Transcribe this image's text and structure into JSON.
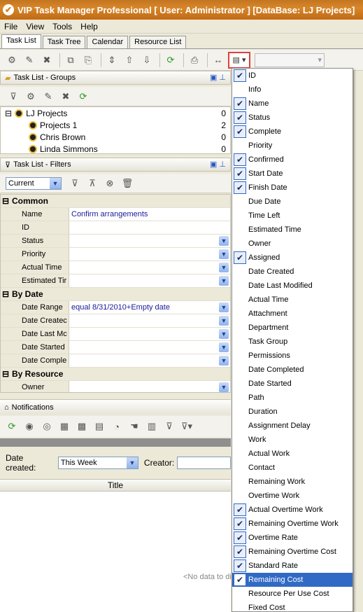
{
  "window": {
    "title": "VIP Task Manager Professional [ User: Administrator ] [DataBase: LJ Projects]"
  },
  "menubar": [
    "File",
    "View",
    "Tools",
    "Help"
  ],
  "tabs": [
    "Task List",
    "Task Tree",
    "Calendar",
    "Resource List"
  ],
  "groups_panel": {
    "title": "Task List - Groups",
    "items": [
      {
        "label": "LJ Projects",
        "count": "0"
      },
      {
        "label": "Projects 1",
        "count": "2"
      },
      {
        "label": "Chris Brown",
        "count": "0"
      },
      {
        "label": "Linda Simmons",
        "count": "0"
      }
    ]
  },
  "filters_panel": {
    "title": "Task List - Filters",
    "current_value": "Current",
    "categories": [
      {
        "name": "Common",
        "rows": [
          {
            "name": "Name",
            "value": "Confirm arrangements",
            "dropdown": false
          },
          {
            "name": "ID",
            "value": "",
            "dropdown": false
          },
          {
            "name": "Status",
            "value": "",
            "dropdown": true
          },
          {
            "name": "Priority",
            "value": "",
            "dropdown": true
          },
          {
            "name": "Actual Time",
            "value": "",
            "dropdown": true
          },
          {
            "name": "Estimated Tir",
            "value": "",
            "dropdown": true
          }
        ]
      },
      {
        "name": "By Date",
        "rows": [
          {
            "name": "Date Range",
            "value": "equal 8/31/2010+Empty date",
            "dropdown": true
          },
          {
            "name": "Date Createc",
            "value": "",
            "dropdown": true
          },
          {
            "name": "Date Last Mc",
            "value": "",
            "dropdown": true
          },
          {
            "name": "Date Started",
            "value": "",
            "dropdown": true
          },
          {
            "name": "Date Comple",
            "value": "",
            "dropdown": true
          }
        ]
      },
      {
        "name": "By Resource",
        "rows": [
          {
            "name": "Owner",
            "value": "",
            "dropdown": true
          }
        ]
      }
    ]
  },
  "notifications": {
    "title": "Notifications",
    "date_created_label": "Date created:",
    "date_created_value": "This Week",
    "creator_label": "Creator:",
    "column_title": "Title",
    "empty_text": "<No data to di"
  },
  "column_menu": {
    "items": [
      {
        "label": "ID",
        "checked": true
      },
      {
        "label": "Info",
        "checked": false
      },
      {
        "label": "Name",
        "checked": true
      },
      {
        "label": "Status",
        "checked": true
      },
      {
        "label": "Complete",
        "checked": true
      },
      {
        "label": "Priority",
        "checked": false
      },
      {
        "label": "Confirmed",
        "checked": true
      },
      {
        "label": "Start Date",
        "checked": true
      },
      {
        "label": "Finish Date",
        "checked": true
      },
      {
        "label": "Due Date",
        "checked": false
      },
      {
        "label": "Time Left",
        "checked": false
      },
      {
        "label": "Estimated Time",
        "checked": false
      },
      {
        "label": "Owner",
        "checked": false
      },
      {
        "label": "Assigned",
        "checked": true
      },
      {
        "label": "Date Created",
        "checked": false
      },
      {
        "label": "Date Last Modified",
        "checked": false
      },
      {
        "label": "Actual Time",
        "checked": false
      },
      {
        "label": "Attachment",
        "checked": false
      },
      {
        "label": "Department",
        "checked": false
      },
      {
        "label": "Task Group",
        "checked": false
      },
      {
        "label": "Permissions",
        "checked": false
      },
      {
        "label": "Date Completed",
        "checked": false
      },
      {
        "label": "Date Started",
        "checked": false
      },
      {
        "label": "Path",
        "checked": false
      },
      {
        "label": "Duration",
        "checked": false
      },
      {
        "label": "Assignment Delay",
        "checked": false
      },
      {
        "label": "Work",
        "checked": false
      },
      {
        "label": "Actual Work",
        "checked": false
      },
      {
        "label": "Contact",
        "checked": false
      },
      {
        "label": "Remaining Work",
        "checked": false
      },
      {
        "label": "Overtime Work",
        "checked": false
      },
      {
        "label": "Actual Overtime Work",
        "checked": true
      },
      {
        "label": "Remaining Overtime Work",
        "checked": true
      },
      {
        "label": "Overtime Rate",
        "checked": true
      },
      {
        "label": "Remaining Overtime Cost",
        "checked": true
      },
      {
        "label": "Standard Rate",
        "checked": true
      },
      {
        "label": "Remaining Cost",
        "checked": true,
        "highlighted": true
      },
      {
        "label": "Resource Per Use Cost",
        "checked": false
      },
      {
        "label": "Fixed Cost",
        "checked": false
      }
    ]
  },
  "colors": {
    "title_bar": "#d8862a",
    "highlight": "#316ac5",
    "button_outline": "#e0403a"
  }
}
